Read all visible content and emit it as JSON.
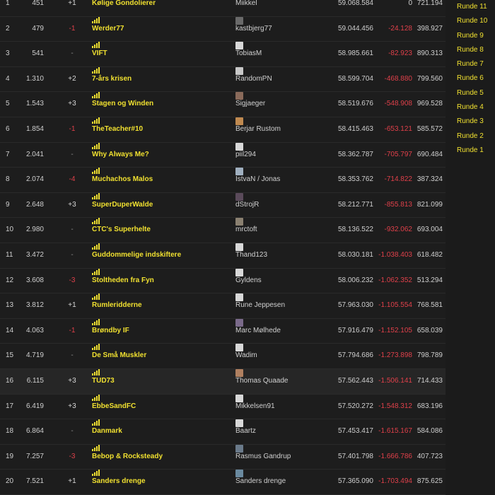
{
  "rows": [
    {
      "rank": "1",
      "position": "451",
      "change": "+1",
      "team": "Kølige Gondolierer",
      "user": "Miikkel",
      "avatar_color": "#7a4a3a",
      "points": "59.068.584",
      "diff": "0",
      "round_points": "721.194"
    },
    {
      "rank": "2",
      "position": "479",
      "change": "-1",
      "team": "Werder77",
      "user": "kastbjerg77",
      "avatar_color": "#6a6a6a",
      "points": "59.044.456",
      "diff": "-24.128",
      "round_points": "398.927"
    },
    {
      "rank": "3",
      "position": "541",
      "change": "-",
      "team": "VIFT",
      "user": "TobiasM",
      "avatar_color": "#d8d8d8",
      "points": "58.985.661",
      "diff": "-82.923",
      "round_points": "890.313"
    },
    {
      "rank": "4",
      "position": "1.310",
      "change": "+2",
      "team": "7-års krisen",
      "user": "RandomPN",
      "avatar_color": "#c8c8c8",
      "points": "58.599.704",
      "diff": "-468.880",
      "round_points": "799.560"
    },
    {
      "rank": "5",
      "position": "1.543",
      "change": "+3",
      "team": "Stagen og Winden",
      "user": "Sigjaeger",
      "avatar_color": "#8a6a5a",
      "points": "58.519.676",
      "diff": "-548.908",
      "round_points": "969.528"
    },
    {
      "rank": "6",
      "position": "1.854",
      "change": "-1",
      "team": "TheTeacher#10",
      "user": "Berjar Rustom",
      "avatar_color": "#c08a50",
      "points": "58.415.463",
      "diff": "-653.121",
      "round_points": "585.572"
    },
    {
      "rank": "7",
      "position": "2.041",
      "change": "-",
      "team": "Why Always Me?",
      "user": "piil294",
      "avatar_color": "#d8d8d8",
      "points": "58.362.787",
      "diff": "-705.797",
      "round_points": "690.484"
    },
    {
      "rank": "8",
      "position": "2.074",
      "change": "-4",
      "team": "Muchachos Malos",
      "user": "IstvaN / Jonas",
      "avatar_color": "#a0b0c0",
      "points": "58.353.762",
      "diff": "-714.822",
      "round_points": "387.324"
    },
    {
      "rank": "9",
      "position": "2.648",
      "change": "+3",
      "team": "SuperDuperWalde",
      "user": "dStrojR",
      "avatar_color": "#5a4a5a",
      "points": "58.212.771",
      "diff": "-855.813",
      "round_points": "821.099"
    },
    {
      "rank": "10",
      "position": "2.980",
      "change": "-",
      "team": "CTC's Superhelte",
      "user": "mrctoft",
      "avatar_color": "#8a8070",
      "points": "58.136.522",
      "diff": "-932.062",
      "round_points": "693.004"
    },
    {
      "rank": "11",
      "position": "3.472",
      "change": "-",
      "team": "Guddommelige indskiftere",
      "user": "Thand123",
      "avatar_color": "#d8d8d8",
      "points": "58.030.181",
      "diff": "-1.038.403",
      "round_points": "618.482"
    },
    {
      "rank": "12",
      "position": "3.608",
      "change": "-3",
      "team": "Stoltheden fra Fyn",
      "user": "Gyldens",
      "avatar_color": "#d8d8d8",
      "points": "58.006.232",
      "diff": "-1.062.352",
      "round_points": "513.294"
    },
    {
      "rank": "13",
      "position": "3.812",
      "change": "+1",
      "team": "Rumleridderne",
      "user": "Rune Jeppesen",
      "avatar_color": "#d8d8d8",
      "points": "57.963.030",
      "diff": "-1.105.554",
      "round_points": "768.581"
    },
    {
      "rank": "14",
      "position": "4.063",
      "change": "-1",
      "team": "Brøndby IF",
      "user": "Marc Mølhede",
      "avatar_color": "#7a6a8a",
      "points": "57.916.479",
      "diff": "-1.152.105",
      "round_points": "658.039"
    },
    {
      "rank": "15",
      "position": "4.719",
      "change": "-",
      "team": "De Små Muskler",
      "user": "Wadim",
      "avatar_color": "#d8d8d8",
      "points": "57.794.686",
      "diff": "-1.273.898",
      "round_points": "798.789"
    },
    {
      "rank": "16",
      "position": "6.115",
      "change": "+3",
      "team": "TUD73",
      "user": "Thomas Quaade",
      "avatar_color": "#b08060",
      "points": "57.562.443",
      "diff": "-1.506.141",
      "round_points": "714.433"
    },
    {
      "rank": "17",
      "position": "6.419",
      "change": "+3",
      "team": "EbbeSandFC",
      "user": "Mikkelsen91",
      "avatar_color": "#d8d8d8",
      "points": "57.520.272",
      "diff": "-1.548.312",
      "round_points": "683.196"
    },
    {
      "rank": "18",
      "position": "6.864",
      "change": "-",
      "team": "Danmark",
      "user": "Baartz",
      "avatar_color": "#d8d8d8",
      "points": "57.453.417",
      "diff": "-1.615.167",
      "round_points": "584.086"
    },
    {
      "rank": "19",
      "position": "7.257",
      "change": "-3",
      "team": "Bebop & Rocksteady",
      "user": "Rasmus Gandrup",
      "avatar_color": "#6a7a8a",
      "points": "57.401.798",
      "diff": "-1.666.786",
      "round_points": "407.723"
    },
    {
      "rank": "20",
      "position": "7.521",
      "change": "+1",
      "team": "Sanders drenge",
      "user": "Sanders drenge",
      "avatar_color": "#6a8aa0",
      "points": "57.365.090",
      "diff": "-1.703.494",
      "round_points": "875.625"
    }
  ],
  "highlighted_row": 15,
  "rounds": [
    "Runde 11",
    "Runde 10",
    "Runde 9",
    "Runde 8",
    "Runde 7",
    "Runde 6",
    "Runde 5",
    "Runde 4",
    "Runde 3",
    "Runde 2",
    "Runde 1"
  ],
  "colors": {
    "accent": "#f0e030",
    "negative": "#e0404a",
    "background": "#1b1b1b"
  },
  "icons": {
    "team": "signal-bars-icon",
    "user": "avatar"
  }
}
